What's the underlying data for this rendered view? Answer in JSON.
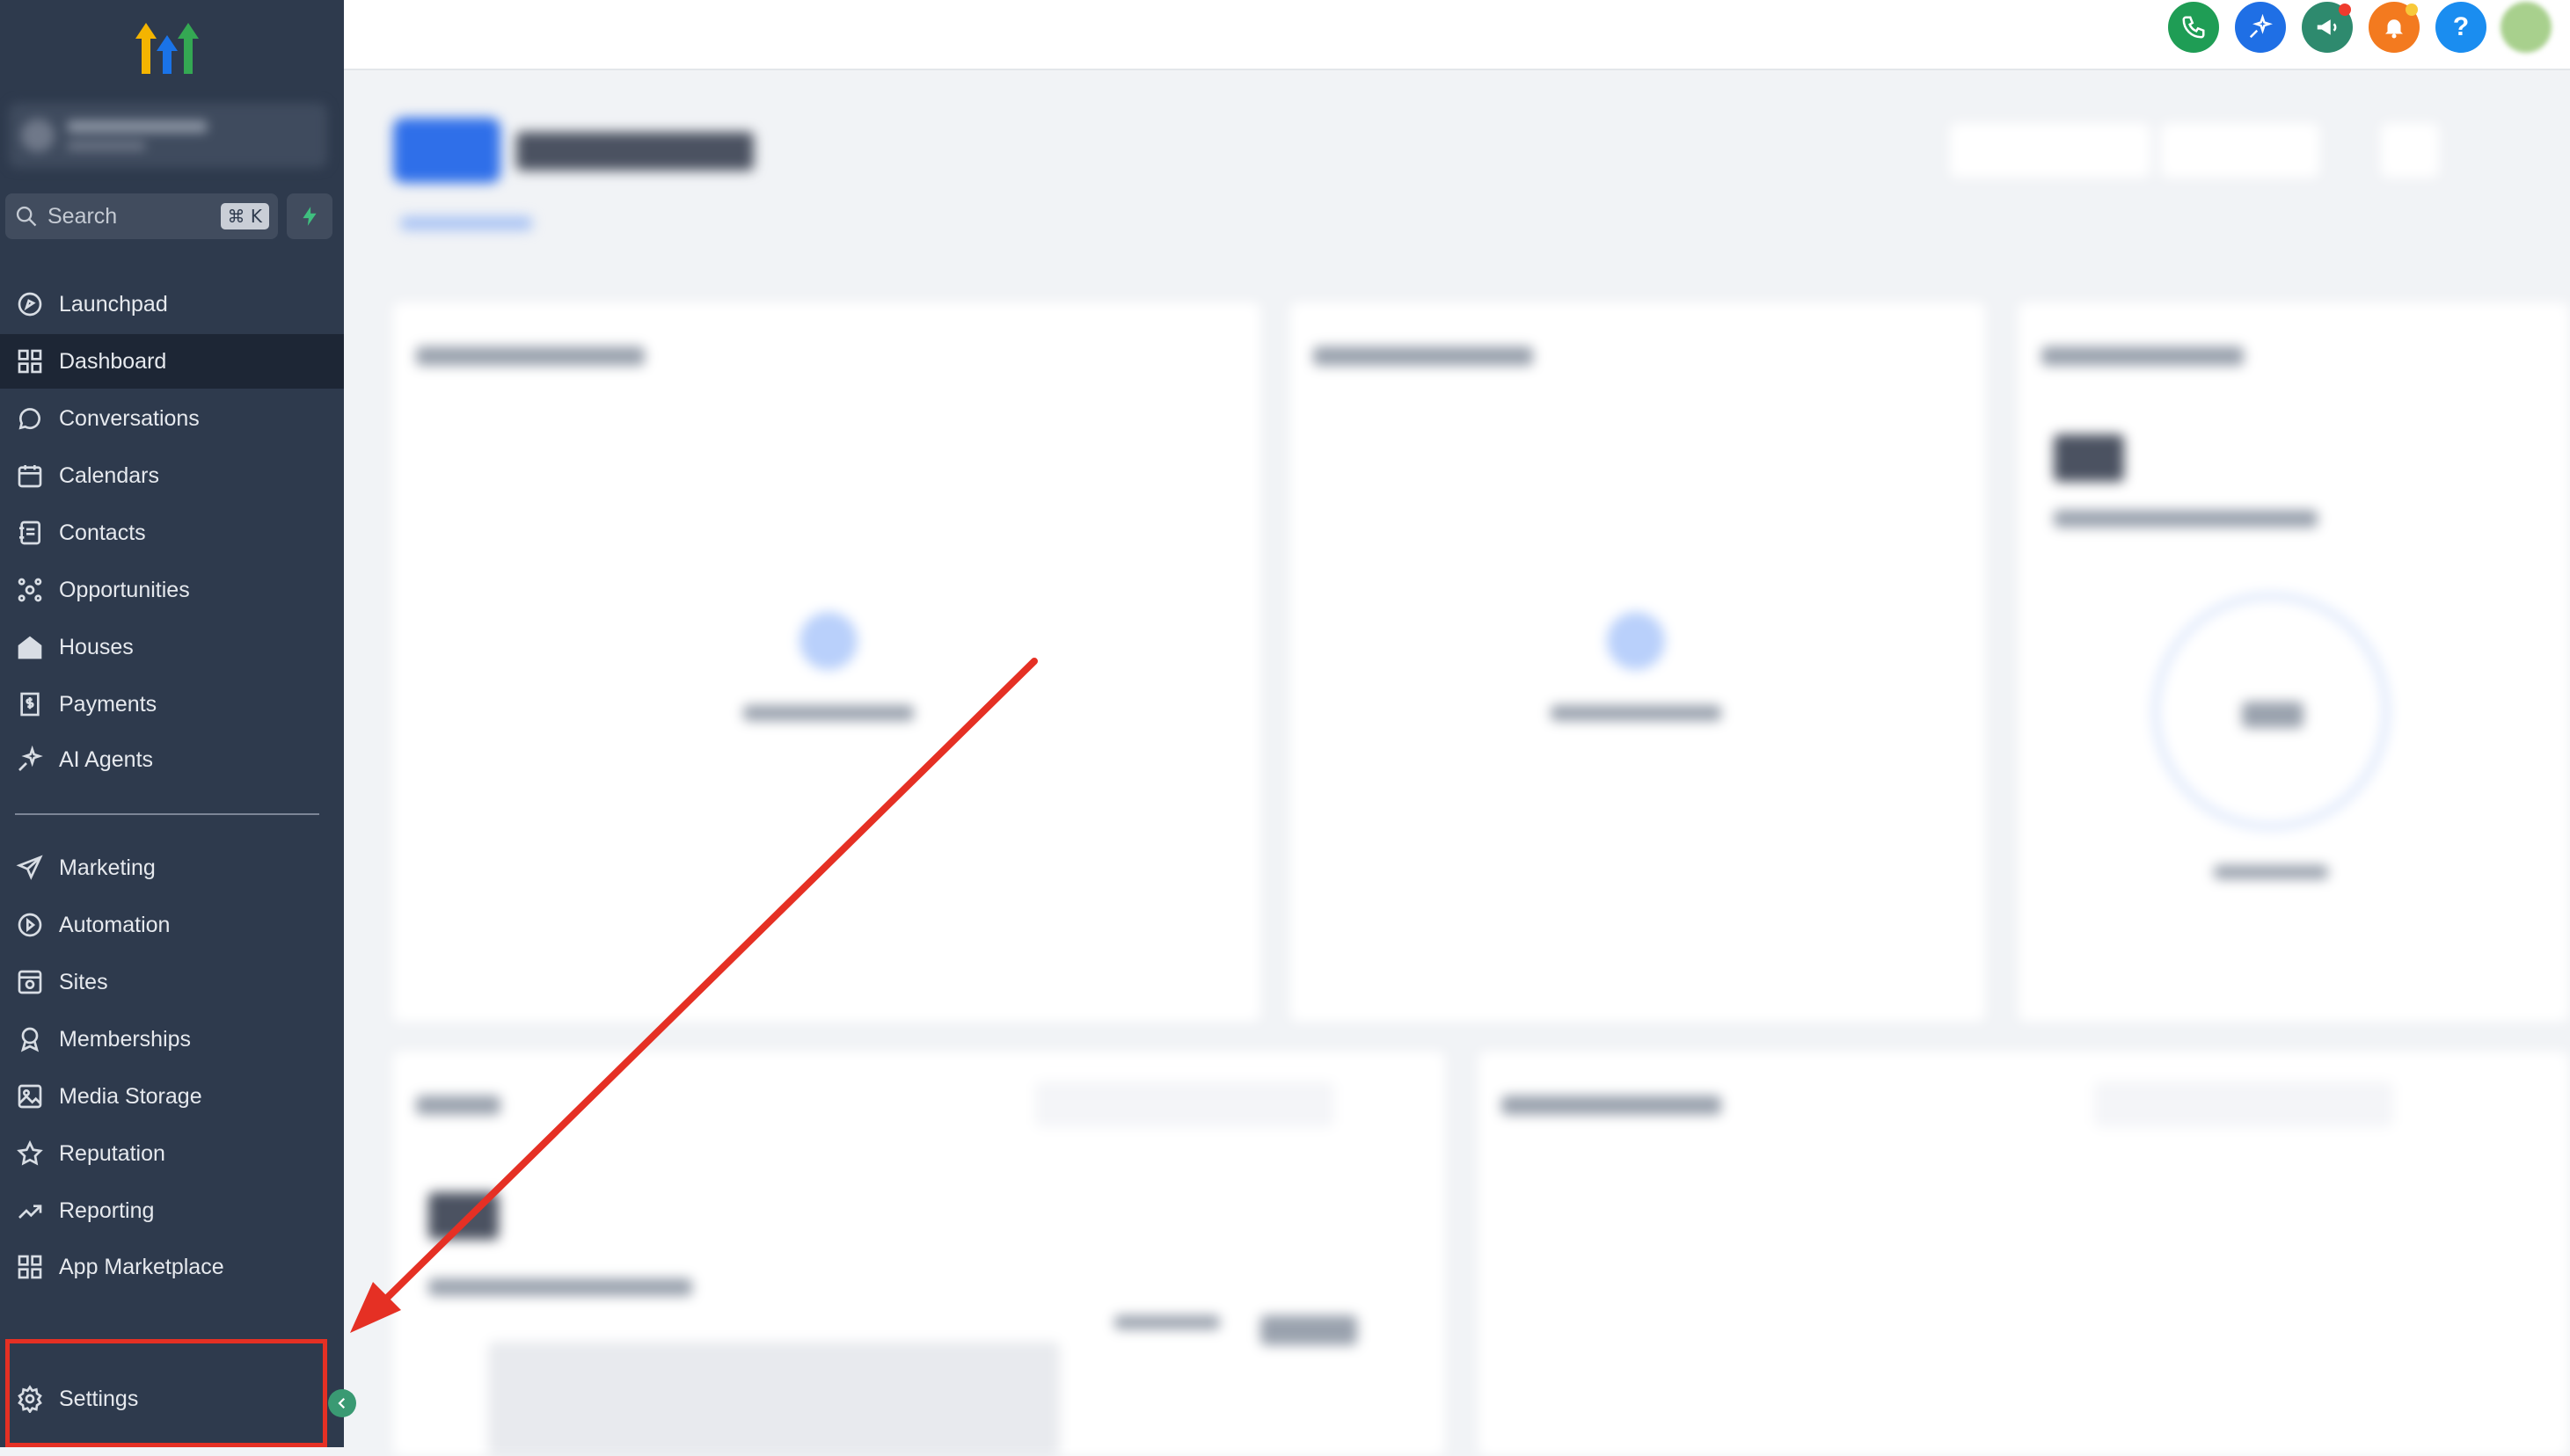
{
  "sidebar": {
    "search": {
      "placeholder": "Search",
      "shortcut": "⌘ K"
    },
    "items_primary": [
      {
        "label": "Launchpad",
        "icon": "launchpad-icon"
      },
      {
        "label": "Dashboard",
        "icon": "dashboard-icon",
        "active": true
      },
      {
        "label": "Conversations",
        "icon": "chat-bubble-icon"
      },
      {
        "label": "Calendars",
        "icon": "calendar-icon"
      },
      {
        "label": "Contacts",
        "icon": "contacts-book-icon"
      },
      {
        "label": "Opportunities",
        "icon": "opportunities-icon"
      },
      {
        "label": "Houses",
        "icon": "house-icon"
      },
      {
        "label": "Payments",
        "icon": "payments-receipt-icon"
      },
      {
        "label": "AI Agents",
        "icon": "sparkle-icon"
      }
    ],
    "items_secondary": [
      {
        "label": "Marketing",
        "icon": "send-icon"
      },
      {
        "label": "Automation",
        "icon": "automation-icon"
      },
      {
        "label": "Sites",
        "icon": "sites-icon"
      },
      {
        "label": "Memberships",
        "icon": "badge-icon"
      },
      {
        "label": "Media Storage",
        "icon": "image-icon"
      },
      {
        "label": "Reputation",
        "icon": "star-icon"
      },
      {
        "label": "Reporting",
        "icon": "trend-icon"
      },
      {
        "label": "App Marketplace",
        "icon": "grid-icon"
      }
    ],
    "settings": {
      "label": "Settings",
      "icon": "gear-icon"
    }
  },
  "topbar": {
    "buttons": [
      {
        "name": "phone",
        "icon": "phone-icon",
        "color": "#1f9d55"
      },
      {
        "name": "ai-assistant",
        "icon": "magic-wand-icon",
        "color": "#1f6fe5"
      },
      {
        "name": "announcements",
        "icon": "megaphone-icon",
        "color": "#2e8a6e"
      },
      {
        "name": "notifications",
        "icon": "bell-icon",
        "color": "#f37a1f"
      },
      {
        "name": "help",
        "icon": "question-icon",
        "color": "#1a8df0"
      }
    ],
    "help_glyph": "?"
  },
  "annotation": {
    "arrow_color": "#e53024",
    "highlight_color": "#e53024"
  },
  "colors": {
    "sidebar_bg": "#2e3a4d",
    "sidebar_active_bg": "#1d2635",
    "page_bg": "#f1f3f6",
    "accent": "#1f6fe5"
  }
}
